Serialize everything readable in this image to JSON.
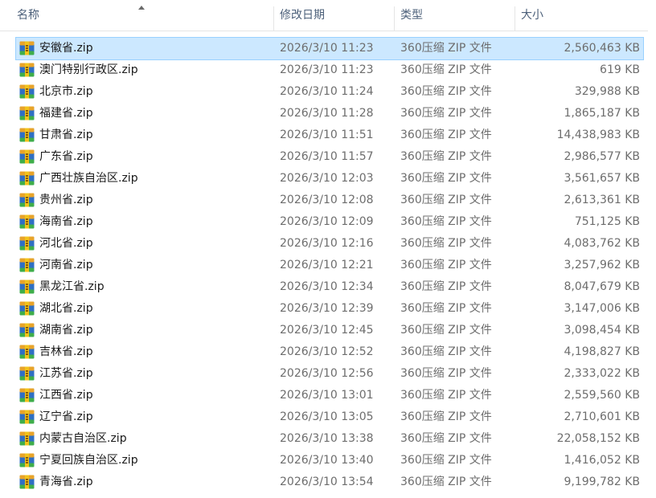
{
  "columns": {
    "name": "名称",
    "date": "修改日期",
    "type": "类型",
    "size": "大小"
  },
  "icon": "zip-archive-icon",
  "selected_index": 0,
  "files": [
    {
      "name": "安徽省.zip",
      "date": "2026/3/10 11:23",
      "type": "360压缩 ZIP 文件",
      "size": "2,560,463 KB"
    },
    {
      "name": "澳门特别行政区.zip",
      "date": "2026/3/10 11:23",
      "type": "360压缩 ZIP 文件",
      "size": "619 KB"
    },
    {
      "name": "北京市.zip",
      "date": "2026/3/10 11:24",
      "type": "360压缩 ZIP 文件",
      "size": "329,988 KB"
    },
    {
      "name": "福建省.zip",
      "date": "2026/3/10 11:28",
      "type": "360压缩 ZIP 文件",
      "size": "1,865,187 KB"
    },
    {
      "name": "甘肃省.zip",
      "date": "2026/3/10 11:51",
      "type": "360压缩 ZIP 文件",
      "size": "14,438,983 KB"
    },
    {
      "name": "广东省.zip",
      "date": "2026/3/10 11:57",
      "type": "360压缩 ZIP 文件",
      "size": "2,986,577 KB"
    },
    {
      "name": "广西壮族自治区.zip",
      "date": "2026/3/10 12:03",
      "type": "360压缩 ZIP 文件",
      "size": "3,561,657 KB"
    },
    {
      "name": "贵州省.zip",
      "date": "2026/3/10 12:08",
      "type": "360压缩 ZIP 文件",
      "size": "2,613,361 KB"
    },
    {
      "name": "海南省.zip",
      "date": "2026/3/10 12:09",
      "type": "360压缩 ZIP 文件",
      "size": "751,125 KB"
    },
    {
      "name": "河北省.zip",
      "date": "2026/3/10 12:16",
      "type": "360压缩 ZIP 文件",
      "size": "4,083,762 KB"
    },
    {
      "name": "河南省.zip",
      "date": "2026/3/10 12:21",
      "type": "360压缩 ZIP 文件",
      "size": "3,257,962 KB"
    },
    {
      "name": "黑龙江省.zip",
      "date": "2026/3/10 12:34",
      "type": "360压缩 ZIP 文件",
      "size": "8,047,679 KB"
    },
    {
      "name": "湖北省.zip",
      "date": "2026/3/10 12:39",
      "type": "360压缩 ZIP 文件",
      "size": "3,147,006 KB"
    },
    {
      "name": "湖南省.zip",
      "date": "2026/3/10 12:45",
      "type": "360压缩 ZIP 文件",
      "size": "3,098,454 KB"
    },
    {
      "name": "吉林省.zip",
      "date": "2026/3/10 12:52",
      "type": "360压缩 ZIP 文件",
      "size": "4,198,827 KB"
    },
    {
      "name": "江苏省.zip",
      "date": "2026/3/10 12:56",
      "type": "360压缩 ZIP 文件",
      "size": "2,333,022 KB"
    },
    {
      "name": "江西省.zip",
      "date": "2026/3/10 13:01",
      "type": "360压缩 ZIP 文件",
      "size": "2,559,560 KB"
    },
    {
      "name": "辽宁省.zip",
      "date": "2026/3/10 13:05",
      "type": "360压缩 ZIP 文件",
      "size": "2,710,601 KB"
    },
    {
      "name": "内蒙古自治区.zip",
      "date": "2026/3/10 13:38",
      "type": "360压缩 ZIP 文件",
      "size": "22,058,152 KB"
    },
    {
      "name": "宁夏回族自治区.zip",
      "date": "2026/3/10 13:40",
      "type": "360压缩 ZIP 文件",
      "size": "1,416,052 KB"
    },
    {
      "name": "青海省.zip",
      "date": "2026/3/10 13:54",
      "type": "360压缩 ZIP 文件",
      "size": "9,199,782 KB"
    }
  ]
}
